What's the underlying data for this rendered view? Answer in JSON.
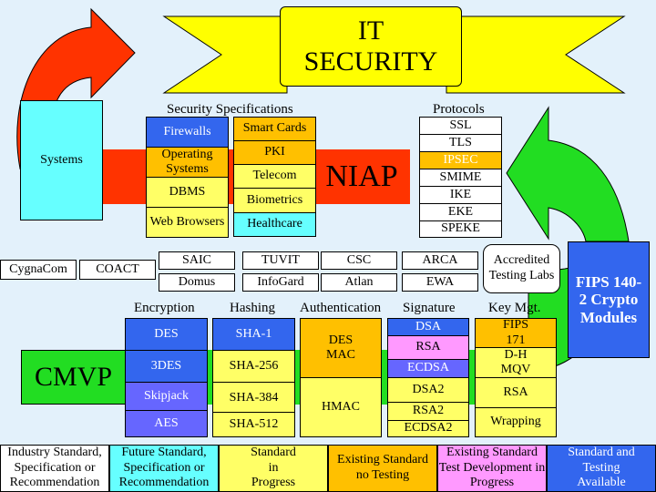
{
  "title": {
    "line1": "IT",
    "line2": "SECURITY"
  },
  "colors": {
    "background": "#e3f1fb",
    "banner_yellow": "#ffff00",
    "niap_red": "#ff3300",
    "cmvp_green": "#22dd22",
    "blue": "#3366ee",
    "purple": "#6666ff",
    "orange": "#ffc000",
    "light_yellow": "#ffff66",
    "pink": "#ff99ff",
    "cyan": "#66ffff"
  },
  "systems": {
    "label": "Systems"
  },
  "niap": {
    "label": "NIAP"
  },
  "cmvp": {
    "label": "CMVP"
  },
  "fips": {
    "label": "FIPS 140-2 Crypto Modules"
  },
  "security_specs": {
    "heading": "Security Specifications",
    "left": [
      {
        "label": "Firewalls",
        "status": "standard-and-testing"
      },
      {
        "label": "Operating Systems",
        "status": "existing-no-testing"
      },
      {
        "label": "DBMS",
        "status": "in-progress"
      },
      {
        "label": "Web Browsers",
        "status": "in-progress"
      }
    ],
    "right": [
      {
        "label": "Smart Cards",
        "status": "existing-no-testing"
      },
      {
        "label": "PKI",
        "status": "existing-no-testing"
      },
      {
        "label": "Telecom",
        "status": "in-progress"
      },
      {
        "label": "Biometrics",
        "status": "in-progress"
      },
      {
        "label": "Healthcare",
        "status": "future"
      }
    ]
  },
  "protocols": {
    "heading": "Protocols",
    "items": [
      {
        "label": "SSL",
        "status": "industry"
      },
      {
        "label": "TLS",
        "status": "industry"
      },
      {
        "label": "IPSEC",
        "status": "existing-no-testing"
      },
      {
        "label": "SMIME",
        "status": "industry"
      },
      {
        "label": "IKE",
        "status": "industry"
      },
      {
        "label": "EKE",
        "status": "industry"
      },
      {
        "label": "SPEKE",
        "status": "industry"
      }
    ]
  },
  "labs": {
    "accredited_label": "Accredited Testing Labs",
    "left": [
      "CygnaCom",
      "COACT"
    ],
    "top_row": [
      "SAIC",
      "TUVIT",
      "CSC",
      "ARCA"
    ],
    "bottom_row": [
      "Domus",
      "InfoGard",
      "Atlan",
      "EWA"
    ]
  },
  "algorithms": {
    "encryption": {
      "heading": "Encryption",
      "items": [
        "DES",
        "3DES",
        "Skipjack",
        "AES"
      ]
    },
    "hashing": {
      "heading": "Hashing",
      "items": [
        "SHA-1",
        "SHA-256",
        "SHA-384",
        "SHA-512"
      ]
    },
    "authentication": {
      "heading": "Authentication",
      "items": [
        "DES MAC",
        "HMAC"
      ]
    },
    "signature": {
      "heading": "Signature",
      "items": [
        "DSA",
        "RSA",
        "ECDSA",
        "DSA2",
        "RSA2",
        "ECDSA2"
      ]
    },
    "key_mgt": {
      "heading": "Key Mgt.",
      "items": [
        "FIPS 171",
        "D-H MQV",
        "RSA",
        "Wrapping"
      ]
    }
  },
  "legend": [
    {
      "label": "Industry Standard, Specification or Recommendation",
      "color": "#ffffff"
    },
    {
      "label": "Future Standard, Specification or Recommendation",
      "color": "#66ffff"
    },
    {
      "label": "Standard in Progress",
      "color": "#ffff66"
    },
    {
      "label": "Existing Standard no Testing",
      "color": "#ffc000"
    },
    {
      "label": "Existing Standard Test Development in Progress",
      "color": "#ff99ff"
    },
    {
      "label": "Standard and Testing Available",
      "color": "#3366ee"
    }
  ]
}
